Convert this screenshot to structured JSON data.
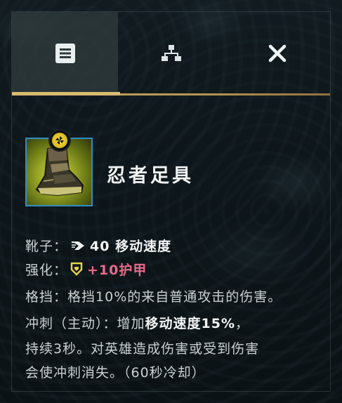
{
  "tabs": [
    {
      "name": "info",
      "icon": "list-icon",
      "active": true
    },
    {
      "name": "tree",
      "icon": "tree-icon",
      "active": false
    },
    {
      "name": "close",
      "icon": "close-icon",
      "active": false
    }
  ],
  "item": {
    "name": "忍者足具",
    "icon": "ninja-tabi-boot-icon",
    "badge_icon": "tier-badge-icon"
  },
  "stats": {
    "boots_label": "靴子：",
    "boots_value": "40 移动速度",
    "enhance_label": "强化：",
    "enhance_value": "+10护甲",
    "block_label": "格挡：",
    "block_text": "格挡10%的来自普通攻击的伤害。",
    "dash_label": "冲刺（主动）：",
    "dash_text_1a": "增加",
    "dash_text_1b": "移动速度15%",
    "dash_text_1c": "，",
    "dash_text_2": "持续3秒。对英雄造成伤害或受到伤害",
    "dash_text_3": "会使冲刺消失。（60秒冷却）"
  },
  "colors": {
    "accent_gold": "#d8bb72",
    "icon_border": "#2e8fc6",
    "armor_pink": "#e66a8a",
    "badge_yellow": "#f5e24a"
  }
}
